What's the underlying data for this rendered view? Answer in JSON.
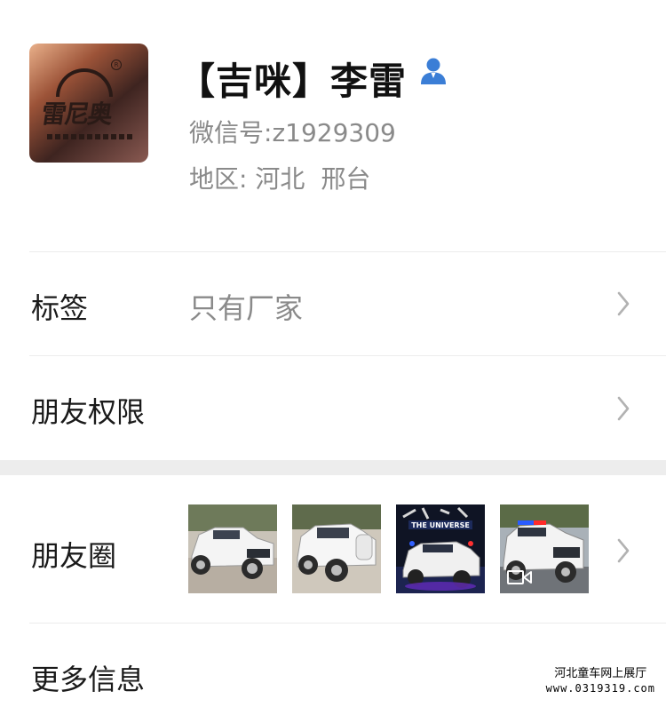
{
  "profile": {
    "nickname": "【吉咪】李雷",
    "wechat_id_label": "微信号:",
    "wechat_id_value": "z1929309",
    "region_label": "地区:",
    "region_province": "河北",
    "region_city": "邢台",
    "avatar_brand_text": "雷尼奥",
    "user_icon": "person-icon",
    "accent_color": "#3b7ed6"
  },
  "rows": {
    "tags": {
      "label": "标签",
      "value": "只有厂家",
      "icon": "chevron-right-icon"
    },
    "permissions": {
      "label": "朋友权限",
      "icon": "chevron-right-icon"
    },
    "moments": {
      "label": "朋友圈",
      "icon": "chevron-right-icon",
      "thumbnails": [
        {
          "name": "white suv ride-on car"
        },
        {
          "name": "white suv ride-on car side view"
        },
        {
          "name": "police ride-on car",
          "caption": "THE UNIVERSE"
        },
        {
          "name": "police ride-on car video",
          "badge": "video-icon"
        }
      ]
    },
    "more_info": {
      "label": "更多信息"
    }
  },
  "watermark": {
    "line1": "河北童车网上展厅",
    "line2": "www.0319319.com"
  }
}
